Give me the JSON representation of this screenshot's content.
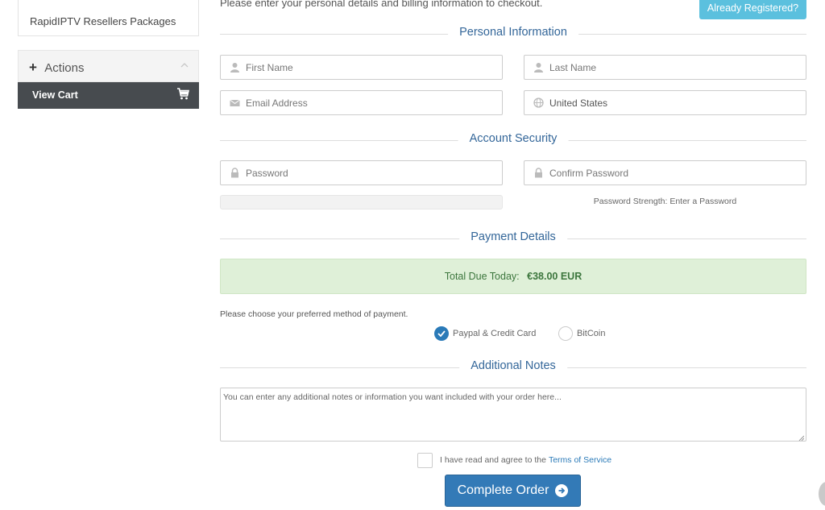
{
  "sidebar": {
    "package_item": "RapidIPTV Resellers Packages",
    "actions_label": "Actions",
    "actions_plus": "+",
    "view_cart": "View Cart"
  },
  "header": {
    "intro": "Please enter your personal details and billing information to checkout.",
    "already_registered": "Already Registered?"
  },
  "sections": {
    "personal": "Personal Information",
    "security": "Account Security",
    "payment": "Payment Details",
    "notes": "Additional Notes"
  },
  "personal": {
    "first_name_placeholder": "First Name",
    "last_name_placeholder": "Last Name",
    "email_placeholder": "Email Address",
    "country_value": "United States"
  },
  "security": {
    "password_placeholder": "Password",
    "confirm_placeholder": "Confirm Password",
    "strength_text": "Password Strength: Enter a Password"
  },
  "payment": {
    "total_label": "Total Due Today:",
    "total_value": "€38.00 EUR",
    "choose_text": "Please choose your preferred method of payment.",
    "methods": [
      {
        "label": "Paypal & Credit Card",
        "selected": true
      },
      {
        "label": "BitCoin",
        "selected": false
      }
    ]
  },
  "notes": {
    "placeholder": "You can enter any additional notes or information you want included with your order here..."
  },
  "tos": {
    "text": "I have read and agree to the",
    "link": "Terms of Service"
  },
  "complete_button": "Complete Order",
  "colors": {
    "accent": "#337ab7",
    "heading": "#336699",
    "info_button": "#5bc0de",
    "success_bg": "#dff0d8",
    "sidebar_dark": "#474b4f"
  },
  "icons": {
    "first_name": "user-icon",
    "last_name": "user-icon",
    "email": "envelope-icon",
    "country": "globe-icon",
    "password": "lock-icon",
    "confirm": "lock-icon",
    "cart": "cart-icon",
    "complete": "arrow-circle-right-icon"
  }
}
